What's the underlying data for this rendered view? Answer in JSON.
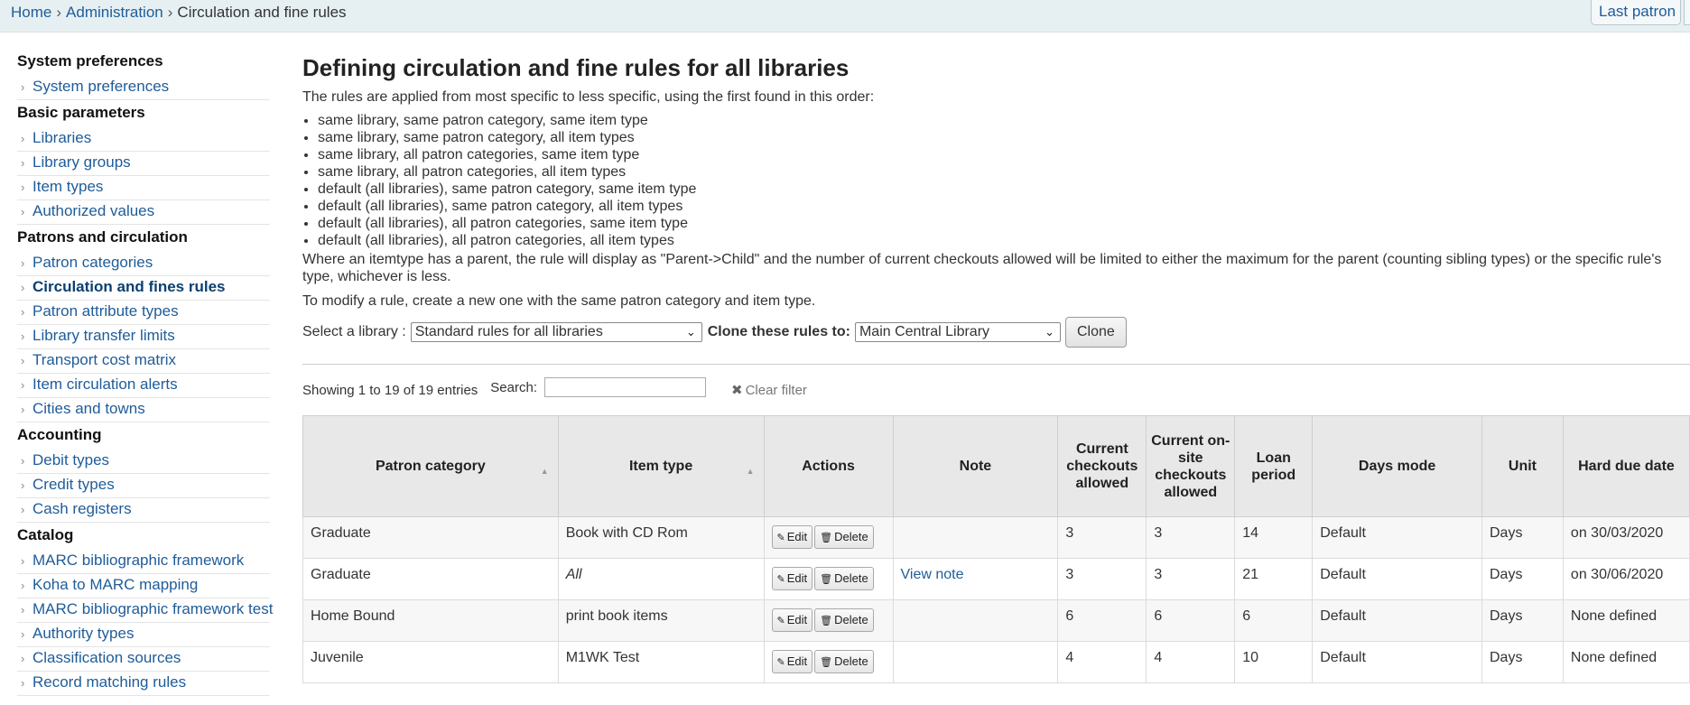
{
  "breadcrumb": {
    "home": "Home",
    "admin": "Administration",
    "current": "Circulation and fine rules",
    "sep": "›"
  },
  "header": {
    "last_patron": "Last patron"
  },
  "sidebar": {
    "sections": [
      {
        "title": "System preferences",
        "items": [
          "System preferences"
        ]
      },
      {
        "title": "Basic parameters",
        "items": [
          "Libraries",
          "Library groups",
          "Item types",
          "Authorized values"
        ]
      },
      {
        "title": "Patrons and circulation",
        "items": [
          "Patron categories",
          "Circulation and fines rules",
          "Patron attribute types",
          "Library transfer limits",
          "Transport cost matrix",
          "Item circulation alerts",
          "Cities and towns"
        ]
      },
      {
        "title": "Accounting",
        "items": [
          "Debit types",
          "Credit types",
          "Cash registers"
        ]
      },
      {
        "title": "Catalog",
        "items": [
          "MARC bibliographic framework",
          "Koha to MARC mapping",
          "MARC bibliographic framework test",
          "Authority types",
          "Classification sources",
          "Record matching rules"
        ]
      }
    ],
    "chevron": "›"
  },
  "main": {
    "title": "Defining circulation and fine rules for all libraries",
    "intro": "The rules are applied from most specific to less specific, using the first found in this order:",
    "order": [
      "same library, same patron category, same item type",
      "same library, same patron category, all item types",
      "same library, all patron categories, same item type",
      "same library, all patron categories, all item types",
      "default (all libraries), same patron category, same item type",
      "default (all libraries), same patron category, all item types",
      "default (all libraries), all patron categories, same item type",
      "default (all libraries), all patron categories, all item types"
    ],
    "parent_note": "Where an itemtype has a parent, the rule will display as \"Parent->Child\" and the number of current checkouts allowed will be limited to either the maximum for the parent (counting sibling types) or the specific rule's type, whichever is less.",
    "modify_note": "To modify a rule, create a new one with the same patron category and item type.",
    "select_library_label": "Select a library :",
    "select_library_value": "Standard rules for all libraries",
    "clone_label": "Clone these rules to:",
    "clone_value": "Main Central Library",
    "clone_button": "Clone",
    "showing": "Showing 1 to 19 of 19 entries",
    "search_label": "Search:",
    "clear_filter": "Clear filter"
  },
  "table": {
    "headers": [
      "Patron category",
      "Item type",
      "Actions",
      "Note",
      "Current checkouts allowed",
      "Current on-site checkouts allowed",
      "Loan period",
      "Days mode",
      "Unit",
      "Hard due date"
    ],
    "edit_label": "Edit",
    "delete_label": "Delete",
    "rows": [
      {
        "patron": "Graduate",
        "itemtype": "Book with CD Rom",
        "note": "",
        "checkouts": "3",
        "onsite": "3",
        "loan": "14",
        "daysmode": "Default",
        "unit": "Days",
        "hardduedate": "on 30/03/2020"
      },
      {
        "patron": "Graduate",
        "itemtype": "All",
        "note": "View note",
        "checkouts": "3",
        "onsite": "3",
        "loan": "21",
        "daysmode": "Default",
        "unit": "Days",
        "hardduedate": "on 30/06/2020"
      },
      {
        "patron": "Home Bound",
        "itemtype": "print book items",
        "note": "",
        "checkouts": "6",
        "onsite": "6",
        "loan": "6",
        "daysmode": "Default",
        "unit": "Days",
        "hardduedate": "None defined"
      },
      {
        "patron": "Juvenile",
        "itemtype": "M1WK Test",
        "note": "",
        "checkouts": "4",
        "onsite": "4",
        "loan": "10",
        "daysmode": "Default",
        "unit": "Days",
        "hardduedate": "None defined"
      }
    ]
  }
}
